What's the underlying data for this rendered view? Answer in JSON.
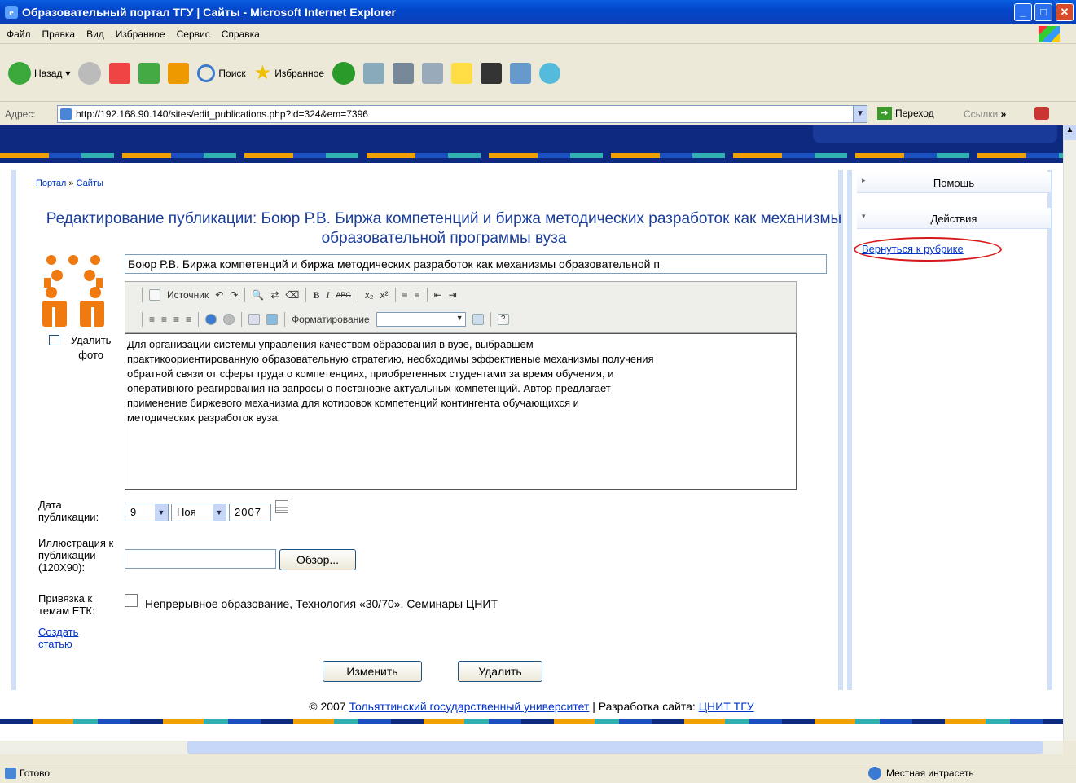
{
  "window": {
    "title": "Образовательный портал ТГУ | Сайты - Microsoft Internet Explorer"
  },
  "menu": [
    "Файл",
    "Правка",
    "Вид",
    "Избранное",
    "Сервис",
    "Справка"
  ],
  "toolbar": {
    "back_label": "Назад",
    "search_label": "Поиск",
    "favorites_label": "Избранное"
  },
  "address": {
    "label": "Адрес:",
    "url": "http://192.168.90.140/sites/edit_publications.php?id=324&em=7396",
    "go_label": "Переход",
    "links_label": "Ссылки"
  },
  "breadcrumb": {
    "portal": "Портал",
    "sep": "»",
    "sites": "Сайты"
  },
  "page": {
    "title": "Редактирование публикации: Боюр Р.В. Биржа компетенций и биржа методических разработок как механизмы образовательной программы вуза",
    "title_value": "Боюр Р.В. Биржа компетенций и биржа методических разработок как механизмы образовательной п",
    "delete_photo_label": "Удалить фото",
    "editor": {
      "source_label": "Источник",
      "format_label": "Форматирование"
    },
    "body_text": "Для организации системы управления качеством образования в вузе, выбравшем\nпрактикоориентированную образовательную стратегию, необходимы эффективные механизмы получения\nобратной связи от сферы труда о компетенциях, приобретенных студентами за время обучения, и\nоперативного реагирования на запросы о постановке актуальных компетенций. Автор предлагает\nприменение биржевого механизма для котировок компетенций контингента обучающихся и\nметодических разработок вуза.",
    "date_label": "Дата публикации:",
    "date_day": "9",
    "date_month": "Ноя",
    "date_year": "2007",
    "illustration_label": "Иллюстрация к публикации (120X90):",
    "browse_label": "Обзор...",
    "topics_label": "Привязка к темам ЕТК:",
    "topics_value": "Непрерывное образование, Технология «30/70», Семинары ЦНИТ",
    "create_article_label": "Создать статью",
    "save_label": "Изменить",
    "delete_label": "Удалить"
  },
  "sidebar": {
    "help": "Помощь",
    "actions": "Действия",
    "back_link": "Вернуться к рубрике"
  },
  "footer": {
    "copyright": "© 2007",
    "university": "Тольяттинский государственный университет",
    "separator": "| Разработка сайта:",
    "developer": "ЦНИТ ТГУ"
  },
  "status": {
    "ready": "Готово",
    "zone": "Местная интрасеть"
  }
}
